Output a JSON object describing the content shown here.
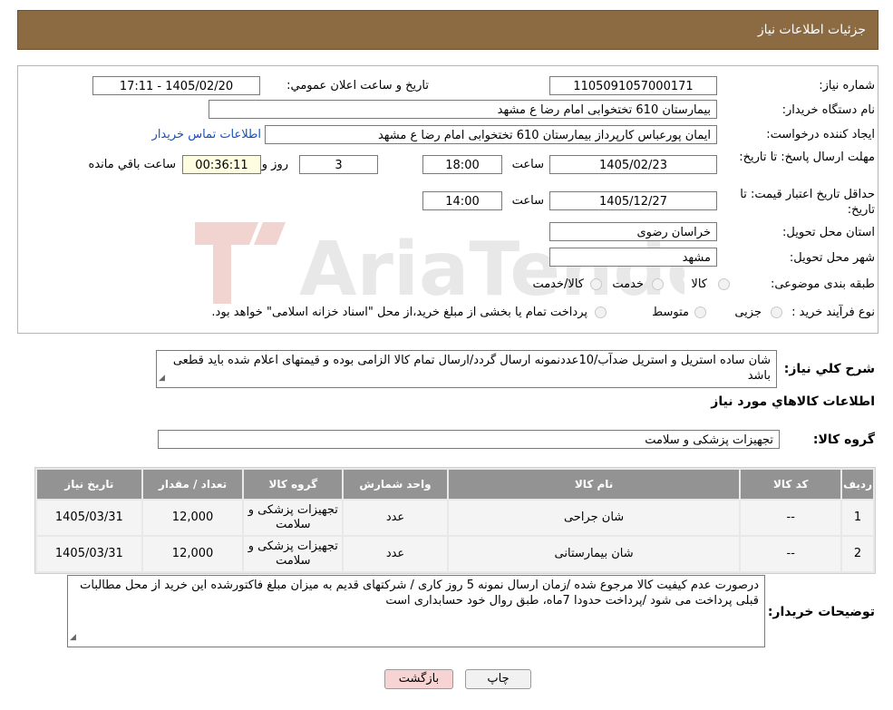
{
  "header": {
    "title": "جزئیات اطلاعات نیاز"
  },
  "form": {
    "need_number": {
      "label": "شماره نیاز:",
      "value": "1105091057000171"
    },
    "announce": {
      "label": "تاریخ و ساعت اعلان عمومي:",
      "value": "1405/02/20 - 17:11"
    },
    "buyer": {
      "label": "نام دستگاه خریدار:",
      "value": "بیمارستان 610 تختخوابی امام رضا ع  مشهد"
    },
    "creator": {
      "label": "ایجاد کننده درخواست:",
      "value": "ایمان پورعباس کارپرداز بیمارستان 610 تختخوابی امام رضا ع  مشهد",
      "contact_link": "اطلاعات تماس خریدار"
    },
    "deadline": {
      "label": "مهلت ارسال پاسخ: تا تاریخ:",
      "date": "1405/02/23",
      "time_label": "ساعت",
      "time": "18:00",
      "days": "3",
      "days_label": "روز و",
      "remaining": "00:36:11",
      "remaining_label": "ساعت باقي مانده"
    },
    "validity": {
      "label": "حداقل تاریخ اعتبار قیمت: تا تاریخ:",
      "date": "1405/12/27",
      "time_label": "ساعت",
      "time": "14:00"
    },
    "province": {
      "label": "استان محل تحویل:",
      "value": "خراسان رضوی"
    },
    "city": {
      "label": "شهر محل تحویل:",
      "value": "مشهد"
    },
    "category": {
      "label": "طبقه بندی موضوعی:",
      "options": [
        "کالا",
        "خدمت",
        "کالا/خدمت"
      ]
    },
    "process": {
      "label": "نوع فرآیند خرید :",
      "options": [
        "جزیی",
        "متوسط"
      ],
      "note": "پرداخت تمام یا بخشی از مبلغ خرید،از محل \"اسناد خزانه اسلامی\" خواهد بود."
    }
  },
  "description": {
    "label": "شرح کلي نیاز:",
    "text": "شان ساده استریل و استریل ضدآب/10عددنمونه ارسال گردد/ارسال تمام کالا الزامی بوده و قیمتهای اعلام شده باید قطعی باشد"
  },
  "goods_section": {
    "title": "اطلاعات کالاهاي مورد نیاز"
  },
  "goods_group": {
    "label": "گروه کالا:",
    "value": "تجهیزات پزشکی و سلامت"
  },
  "table": {
    "headers": [
      "ردیف",
      "کد کالا",
      "نام کالا",
      "واحد شمارش",
      "گروه کالا",
      "تعداد / مقدار",
      "تاریخ نیاز"
    ],
    "rows": [
      [
        "1",
        "--",
        "شان جراحی",
        "عدد",
        "تجهیزات پزشکی و سلامت",
        "12,000",
        "1405/03/31"
      ],
      [
        "2",
        "--",
        "شان بیمارستانی",
        "عدد",
        "تجهیزات پزشکی و سلامت",
        "12,000",
        "1405/03/31"
      ]
    ]
  },
  "buyer_notes": {
    "label": "توضیحات خریدار:",
    "text": "درصورت عدم کیفیت کالا مرجوع شده /زمان ارسال نمونه 5 روز کاری /  شرکتهای قدیم به میزان مبلغ فاکتورشده این خرید از محل مطالبات قبلی پرداخت می شود /پرداخت حدودا 7ماه، طبق روال خود حسابداری است"
  },
  "buttons": {
    "print": "چاپ",
    "back": "بازگشت"
  },
  "colors": {
    "header_bg": "#8c6b43",
    "table_header_bg": "#939393",
    "link": "#1b50b7"
  }
}
